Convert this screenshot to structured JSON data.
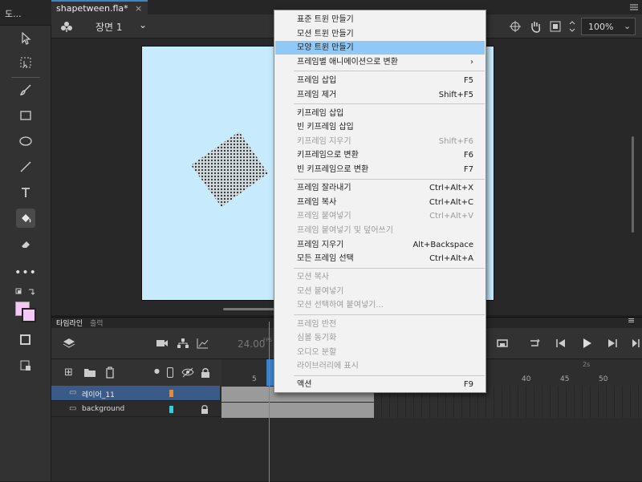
{
  "tools_panel": {
    "title": "도..."
  },
  "document": {
    "tab_title": "shapetween.fla*",
    "close": "×"
  },
  "edit_bar": {
    "scene_label": "장면 1",
    "zoom_value": "100%"
  },
  "timeline": {
    "tab_timeline": "타임라인",
    "tab_output": "출력",
    "fps": "24.00",
    "fps_unit": "FPS",
    "frame_numbers": [
      "5",
      "40",
      "45",
      "50"
    ],
    "seconds_marker": "2s",
    "layers": [
      {
        "name": "레이어_11",
        "color": "#f08a1c",
        "selected": true
      },
      {
        "name": "background",
        "color": "#22d6e8",
        "selected": false,
        "locked": true
      }
    ]
  },
  "context_menu": {
    "groups": [
      [
        {
          "label": "표준 트윈 만들기",
          "shortcut": "",
          "enabled": true
        },
        {
          "label": "모션 트윈 만들기",
          "shortcut": "",
          "enabled": true
        },
        {
          "label": "모양 트윈 만들기",
          "shortcut": "",
          "enabled": true,
          "highlighted": true
        },
        {
          "label": "프레임별 애니메이션으로 변환",
          "shortcut": "›",
          "enabled": true
        }
      ],
      [
        {
          "label": "프레임 삽입",
          "shortcut": "F5",
          "enabled": true
        },
        {
          "label": "프레임 제거",
          "shortcut": "Shift+F5",
          "enabled": true
        }
      ],
      [
        {
          "label": "키프레임 삽입",
          "shortcut": "",
          "enabled": true
        },
        {
          "label": "빈 키프레임 삽입",
          "shortcut": "",
          "enabled": true
        },
        {
          "label": "키프레임 지우기",
          "shortcut": "Shift+F6",
          "enabled": false
        },
        {
          "label": "키프레임으로 변환",
          "shortcut": "F6",
          "enabled": true
        },
        {
          "label": "빈 키프레임으로 변환",
          "shortcut": "F7",
          "enabled": true
        }
      ],
      [
        {
          "label": "프레임 잘라내기",
          "shortcut": "Ctrl+Alt+X",
          "enabled": true
        },
        {
          "label": "프레임 복사",
          "shortcut": "Ctrl+Alt+C",
          "enabled": true
        },
        {
          "label": "프레임 붙여넣기",
          "shortcut": "Ctrl+Alt+V",
          "enabled": false
        },
        {
          "label": "프레임 붙여넣기 및 덮어쓰기",
          "shortcut": "",
          "enabled": false
        },
        {
          "label": "프레임 지우기",
          "shortcut": "Alt+Backspace",
          "enabled": true
        },
        {
          "label": "모든 프레임 선택",
          "shortcut": "Ctrl+Alt+A",
          "enabled": true
        }
      ],
      [
        {
          "label": "모션 복사",
          "shortcut": "",
          "enabled": false
        },
        {
          "label": "모션 붙여넣기",
          "shortcut": "",
          "enabled": false
        },
        {
          "label": "모션 선택하여 붙여넣기...",
          "shortcut": "",
          "enabled": false
        }
      ],
      [
        {
          "label": "프레임 반전",
          "shortcut": "",
          "enabled": false
        },
        {
          "label": "심볼 동기화",
          "shortcut": "",
          "enabled": false
        },
        {
          "label": "오디오 분할",
          "shortcut": "",
          "enabled": false
        },
        {
          "label": "라이브러리에 표시",
          "shortcut": "",
          "enabled": false
        }
      ],
      [
        {
          "label": "액션",
          "shortcut": "F9",
          "enabled": true
        }
      ]
    ]
  },
  "colors": {
    "stage": "#c7ebfd",
    "menu_highlight": "#90c8f6",
    "accent": "#3a86c8"
  }
}
